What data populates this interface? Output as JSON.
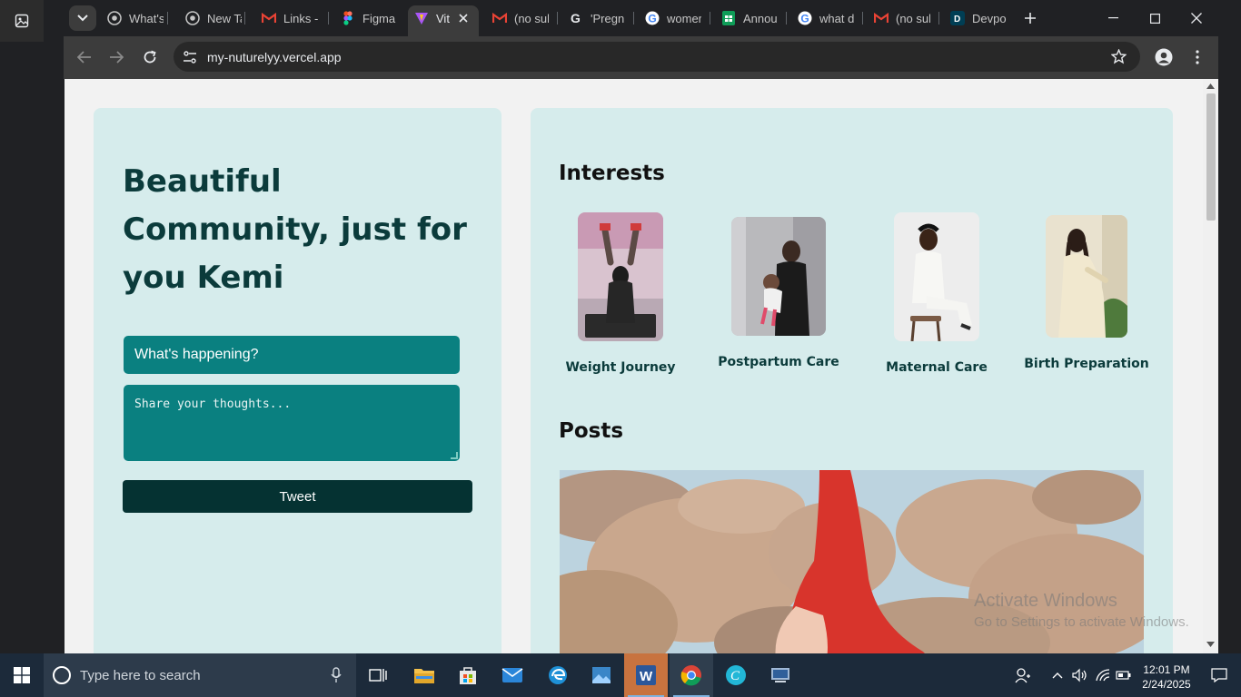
{
  "browser": {
    "tabs": [
      {
        "label": "What's",
        "icon": "chrome-icon"
      },
      {
        "label": "New Ta",
        "icon": "chrome-icon"
      },
      {
        "label": "Links -",
        "icon": "gmail-icon"
      },
      {
        "label": "Figma",
        "icon": "figma-icon"
      },
      {
        "label": "Vit",
        "icon": "vite-icon",
        "active": true
      },
      {
        "label": "(no sul",
        "icon": "gmail-icon"
      },
      {
        "label": "'Pregn",
        "icon": "google-icon"
      },
      {
        "label": "womer",
        "icon": "google-icon"
      },
      {
        "label": "Annou",
        "icon": "sheets-icon"
      },
      {
        "label": "what d",
        "icon": "google-icon"
      },
      {
        "label": "(no sul",
        "icon": "gmail-icon"
      },
      {
        "label": "Devpo",
        "icon": "devpost-icon"
      }
    ],
    "url": "my-nuturelyy.vercel.app"
  },
  "page": {
    "hero_title": "Beautiful Community, just for you Kemi",
    "status_prompt": "What's happening?",
    "thoughts_placeholder": "Share your thoughts...",
    "tweet_label": "Tweet",
    "interests_title": "Interests",
    "interests": [
      {
        "label": "Weight Journey"
      },
      {
        "label": "Postpartum Care"
      },
      {
        "label": "Maternal Care"
      },
      {
        "label": "Birth Preparation"
      }
    ],
    "posts_title": "Posts"
  },
  "watermark": {
    "line1": "Activate Windows",
    "line2": "Go to Settings to activate Windows."
  },
  "taskbar": {
    "search_placeholder": "Type here to search",
    "time": "12:01 PM",
    "date": "2/24/2025"
  },
  "colors": {
    "card_bg": "#d6ecec",
    "teal": "#0a8080",
    "dark_teal": "#053232",
    "heading": "#0b3b3b"
  }
}
